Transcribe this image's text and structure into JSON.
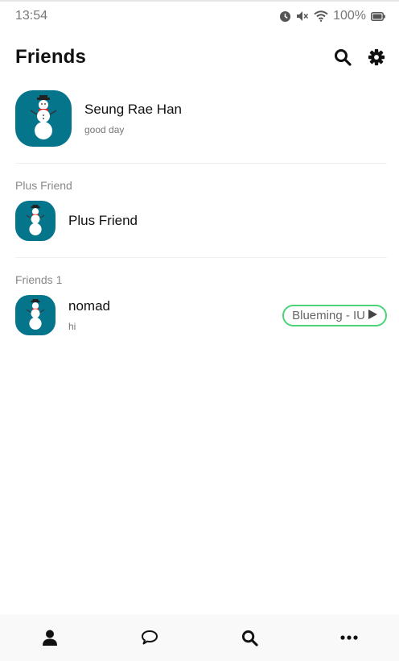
{
  "status_bar": {
    "time": "13:54",
    "battery": "100%",
    "icons": [
      "alarm-icon",
      "mute-icon",
      "wifi-icon",
      "battery-icon"
    ]
  },
  "header": {
    "title": "Friends",
    "icons": [
      "search-icon",
      "gear-icon"
    ]
  },
  "profile": {
    "name": "Seung Rae Han",
    "status": "good day",
    "avatar_icon": "snowman-icon"
  },
  "plus_friend_section": {
    "label": "Plus Friend",
    "item": {
      "name": "Plus Friend",
      "avatar_icon": "snowman-icon"
    }
  },
  "friends_section": {
    "label": "Friends 1",
    "items": [
      {
        "name": "nomad",
        "status": "hi",
        "music": "Blueming - IU",
        "avatar_icon": "snowman-icon"
      }
    ]
  },
  "bottom_nav": {
    "items": [
      "person-icon",
      "chat-bubble-icon",
      "search-icon",
      "more-icon"
    ]
  },
  "colors": {
    "avatar_bg": "#05758c",
    "music_border": "#4cd37a",
    "text_primary": "#111111",
    "text_secondary": "#777777",
    "nav_bg": "#f9f9f9"
  }
}
